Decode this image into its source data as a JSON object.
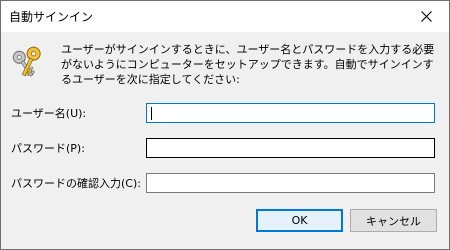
{
  "window": {
    "title": "自動サインイン",
    "close_glyph": "✕"
  },
  "icon": "key-pair-icon",
  "message": "ユーザーがサインインするときに、ユーザー名とパスワードを入力する必要がないようにコンピューターをセットアップできます。自動でサインインするユーザーを次に指定してください:",
  "fields": {
    "username": {
      "label": "ユーザー名(U):",
      "value": ""
    },
    "password": {
      "label": "パスワード(P):",
      "value": ""
    },
    "confirm": {
      "label": "パスワードの確認入力(C):",
      "value": ""
    }
  },
  "buttons": {
    "ok": "OK",
    "cancel": "キャンセル"
  },
  "colors": {
    "focus_border": "#0078d7",
    "dialog_bg": "#f0f0f0"
  }
}
